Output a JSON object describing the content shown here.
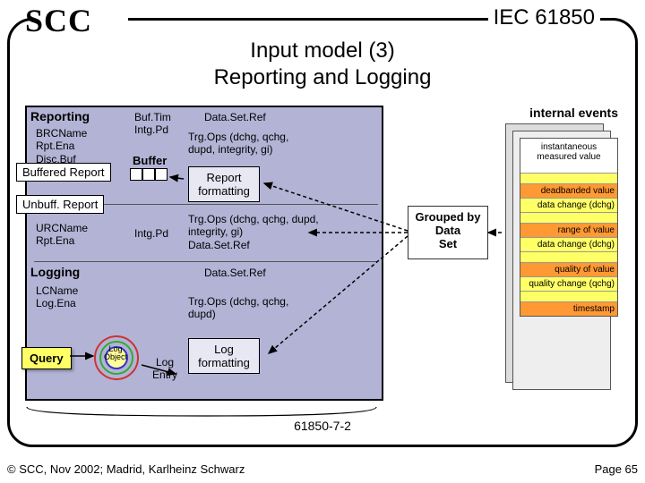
{
  "header": {
    "logo": "SCC",
    "standard": "IEC 61850",
    "title_l1": "Input model (3)",
    "title_l2": "Reporting and Logging"
  },
  "block": {
    "reporting": {
      "label": "Reporting",
      "fields": "BRCName\nRpt.Ena\nDisc.Buf",
      "buf_cfg": "Buf.Tim\nIntg.Pd",
      "dataset": "Data.Set.Ref",
      "trg": "Trg.Ops (dchg, qchg, dupd, integrity, gi)",
      "buffer": "Buffer",
      "fmt": "Report formatting"
    },
    "buffered": "Buffered Report",
    "unbuffered": {
      "label": "Unbuff. Report",
      "fields": "URCName\nRpt.Ena",
      "intg": "Intg.Pd",
      "trg": "Trg.Ops (dchg, qchg, dupd, integrity, gi)\nData.Set.Ref"
    },
    "logging": {
      "label": "Logging",
      "fields": "LCName\nLog.Ena",
      "dataset": "Data.Set.Ref",
      "trg": "Trg.Ops (dchg, qchg, dupd)",
      "fmt": "Log formatting",
      "entry": "Log\nEntry",
      "obj": "Log\nObject",
      "query": "Query"
    }
  },
  "group": "Grouped by\nData\nSet",
  "events": {
    "label": "internal events",
    "rows": [
      "instantaneous measured value",
      "",
      "deadbanded value",
      "data change (dchg)",
      "",
      "range of value",
      "data change (dchg)",
      "",
      "quality of value",
      "quality change (qchg)",
      "",
      "timestamp"
    ],
    "classes": [
      "head",
      "yellow",
      "orange",
      "yellow",
      "yellow",
      "orange",
      "yellow",
      "yellow",
      "orange",
      "yellow",
      "yellow",
      "orange"
    ]
  },
  "scope": "61850-7-2",
  "footer": {
    "left": "© SCC, Nov 2002; Madrid, Karlheinz Schwarz",
    "right": "Page 65"
  }
}
